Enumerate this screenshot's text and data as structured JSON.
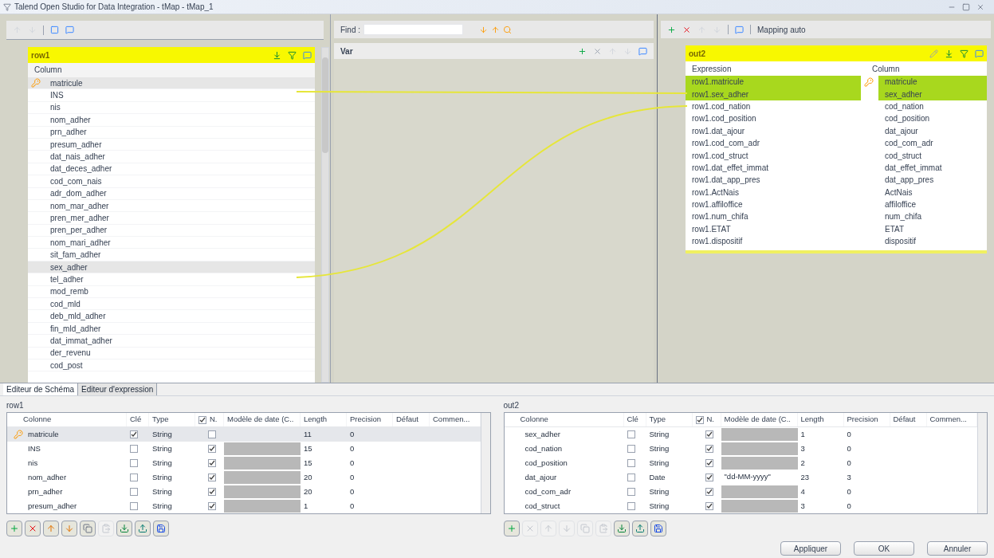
{
  "window": {
    "title": "Talend Open Studio for Data Integration - tMap - tMap_1"
  },
  "find": {
    "label": "Find :"
  },
  "var_table": {
    "title": "Var"
  },
  "input_table": {
    "title": "row1",
    "column_header": "Column",
    "rows": [
      {
        "name": "matricule",
        "key": true,
        "selected": true
      },
      {
        "name": "INS",
        "key": false,
        "selected": false
      },
      {
        "name": "nis",
        "key": false,
        "selected": false
      },
      {
        "name": "nom_adher",
        "key": false,
        "selected": false
      },
      {
        "name": "prn_adher",
        "key": false,
        "selected": false
      },
      {
        "name": "presum_adher",
        "key": false,
        "selected": false
      },
      {
        "name": "dat_nais_adher",
        "key": false,
        "selected": false
      },
      {
        "name": "dat_deces_adher",
        "key": false,
        "selected": false
      },
      {
        "name": "cod_com_nais",
        "key": false,
        "selected": false
      },
      {
        "name": "adr_dom_adher",
        "key": false,
        "selected": false
      },
      {
        "name": "nom_mar_adher",
        "key": false,
        "selected": false
      },
      {
        "name": "pren_mer_adher",
        "key": false,
        "selected": false
      },
      {
        "name": "pren_per_adher",
        "key": false,
        "selected": false
      },
      {
        "name": "nom_mari_adher",
        "key": false,
        "selected": false
      },
      {
        "name": "sit_fam_adher",
        "key": false,
        "selected": false
      },
      {
        "name": "sex_adher",
        "key": false,
        "selected": true
      },
      {
        "name": "tel_adher",
        "key": false,
        "selected": false
      },
      {
        "name": "mod_remb",
        "key": false,
        "selected": false
      },
      {
        "name": "cod_mld",
        "key": false,
        "selected": false
      },
      {
        "name": "deb_mld_adher",
        "key": false,
        "selected": false
      },
      {
        "name": "fin_mld_adher",
        "key": false,
        "selected": false
      },
      {
        "name": "dat_immat_adher",
        "key": false,
        "selected": false
      },
      {
        "name": "der_revenu",
        "key": false,
        "selected": false
      },
      {
        "name": "cod_post",
        "key": false,
        "selected": false
      }
    ]
  },
  "output_toolbar": {
    "mapping_auto": "Mapping auto"
  },
  "output_table": {
    "title": "out2",
    "headers": [
      "Expression",
      "Column"
    ],
    "rows": [
      {
        "expression": "row1.matricule",
        "column": "matricule",
        "key": true,
        "selected": true
      },
      {
        "expression": "row1.sex_adher",
        "column": "sex_adher",
        "key": false,
        "selected": true
      },
      {
        "expression": "row1.cod_nation",
        "column": "cod_nation",
        "key": false,
        "selected": false
      },
      {
        "expression": "row1.cod_position",
        "column": "cod_position",
        "key": false,
        "selected": false
      },
      {
        "expression": "row1.dat_ajour",
        "column": "dat_ajour",
        "key": false,
        "selected": false
      },
      {
        "expression": "row1.cod_com_adr",
        "column": "cod_com_adr",
        "key": false,
        "selected": false
      },
      {
        "expression": "row1.cod_struct",
        "column": "cod_struct",
        "key": false,
        "selected": false
      },
      {
        "expression": "row1.dat_effet_immat",
        "column": "dat_effet_immat",
        "key": false,
        "selected": false
      },
      {
        "expression": "row1.dat_app_pres",
        "column": "dat_app_pres",
        "key": false,
        "selected": false
      },
      {
        "expression": "row1.ActNais",
        "column": "ActNais",
        "key": false,
        "selected": false
      },
      {
        "expression": "row1.affiloffice",
        "column": "affiloffice",
        "key": false,
        "selected": false
      },
      {
        "expression": "row1.num_chifa",
        "column": "num_chifa",
        "key": false,
        "selected": false
      },
      {
        "expression": "row1.ETAT",
        "column": "ETAT",
        "key": false,
        "selected": false
      },
      {
        "expression": "row1.dispositif",
        "column": "dispositif",
        "key": false,
        "selected": false
      }
    ]
  },
  "bottom_tabs": [
    {
      "label": "Editeur de Schéma",
      "selected": true
    },
    {
      "label": "Editeur d'expression",
      "selected": false
    }
  ],
  "schema_tables": [
    {
      "title": "row1",
      "nullable_header_checked": true,
      "columns": [
        "Colonne",
        "Clé",
        "Type",
        "N.",
        "Modèle de date (C..",
        "Length",
        "Precision",
        "Défaut",
        "Commen..."
      ],
      "rows": [
        {
          "colonne": "matricule",
          "key": true,
          "type": "String",
          "nullable": false,
          "date_disabled": false,
          "length": "11",
          "precision": "0",
          "selected": true
        },
        {
          "colonne": "INS",
          "key": false,
          "type": "String",
          "nullable": true,
          "date_disabled": true,
          "length": "15",
          "precision": "0",
          "selected": false
        },
        {
          "colonne": "nis",
          "key": false,
          "type": "String",
          "nullable": true,
          "date_disabled": true,
          "length": "15",
          "precision": "0",
          "selected": false
        },
        {
          "colonne": "nom_adher",
          "key": false,
          "type": "String",
          "nullable": true,
          "date_disabled": true,
          "length": "20",
          "precision": "0",
          "selected": false
        },
        {
          "colonne": "prn_adher",
          "key": false,
          "type": "String",
          "nullable": true,
          "date_disabled": true,
          "length": "20",
          "precision": "0",
          "selected": false
        },
        {
          "colonne": "presum_adher",
          "key": false,
          "type": "String",
          "nullable": true,
          "date_disabled": true,
          "length": "1",
          "precision": "0",
          "selected": false
        }
      ],
      "tools": [
        {
          "kind": "add",
          "disabled": false
        },
        {
          "kind": "remove",
          "disabled": false
        },
        {
          "kind": "up",
          "disabled": false
        },
        {
          "kind": "down",
          "disabled": false
        },
        {
          "kind": "copy",
          "disabled": false
        },
        {
          "kind": "paste",
          "disabled": true
        },
        {
          "kind": "import",
          "disabled": false
        },
        {
          "kind": "export",
          "disabled": false
        },
        {
          "kind": "save",
          "disabled": false
        }
      ]
    },
    {
      "title": "out2",
      "nullable_header_checked": true,
      "columns": [
        "Colonne",
        "Clé",
        "Type",
        "N.",
        "Modèle de date (C..",
        "Length",
        "Precision",
        "Défaut",
        "Commen..."
      ],
      "rows": [
        {
          "colonne": "sex_adher",
          "key": false,
          "type": "String",
          "nullable": true,
          "date_disabled": true,
          "length": "1",
          "precision": "0",
          "selected": false
        },
        {
          "colonne": "cod_nation",
          "key": false,
          "type": "String",
          "nullable": true,
          "date_disabled": true,
          "length": "3",
          "precision": "0",
          "selected": false
        },
        {
          "colonne": "cod_position",
          "key": false,
          "type": "String",
          "nullable": true,
          "date_disabled": true,
          "length": "2",
          "precision": "0",
          "selected": false
        },
        {
          "colonne": "dat_ajour",
          "key": false,
          "type": "Date",
          "nullable": true,
          "date_disabled": false,
          "date_pattern": "\"dd-MM-yyyy\"",
          "length": "23",
          "precision": "3",
          "selected": false
        },
        {
          "colonne": "cod_com_adr",
          "key": false,
          "type": "String",
          "nullable": true,
          "date_disabled": true,
          "length": "4",
          "precision": "0",
          "selected": false
        },
        {
          "colonne": "cod_struct",
          "key": false,
          "type": "String",
          "nullable": true,
          "date_disabled": true,
          "length": "3",
          "precision": "0",
          "selected": false
        }
      ],
      "tools": [
        {
          "kind": "add",
          "disabled": false
        },
        {
          "kind": "remove",
          "disabled": true
        },
        {
          "kind": "up",
          "disabled": true
        },
        {
          "kind": "down",
          "disabled": true
        },
        {
          "kind": "copy",
          "disabled": true
        },
        {
          "kind": "paste",
          "disabled": true
        },
        {
          "kind": "import",
          "disabled": false
        },
        {
          "kind": "export",
          "disabled": false
        },
        {
          "kind": "save",
          "disabled": false
        }
      ]
    }
  ],
  "buttons": [
    "Appliquer",
    "OK",
    "Annuler"
  ]
}
